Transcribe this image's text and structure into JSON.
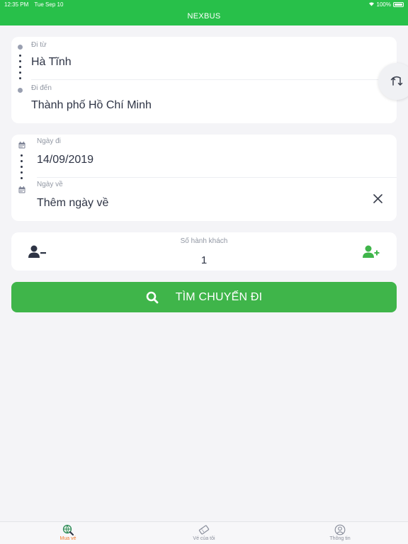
{
  "status": {
    "time": "12:35 PM",
    "date": "Tue Sep 10",
    "battery": "100%"
  },
  "header": {
    "title": "NEXBUS"
  },
  "route": {
    "from_label": "Đi từ",
    "from_value": "Hà Tĩnh",
    "to_label": "Đi đến",
    "to_value": "Thành phố Hồ Chí Minh"
  },
  "dates": {
    "depart_label": "Ngày đi",
    "depart_value": "14/09/2019",
    "return_label": "Ngày về",
    "return_value": "Thêm ngày về"
  },
  "passengers": {
    "label": "Số hành khách",
    "count": "1"
  },
  "search": {
    "label": "TÌM CHUYẾN ĐI"
  },
  "tabs": [
    {
      "label": "Mua vé",
      "icon": "globe-search-icon",
      "active": true
    },
    {
      "label": "Vé của tôi",
      "icon": "ticket-icon",
      "active": false
    },
    {
      "label": "Thông tin",
      "icon": "user-info-icon",
      "active": false
    }
  ],
  "colors": {
    "brand": "#28c04a",
    "button": "#3fb54a",
    "active_tab": "#f07b2c",
    "text": "#2e3445"
  }
}
